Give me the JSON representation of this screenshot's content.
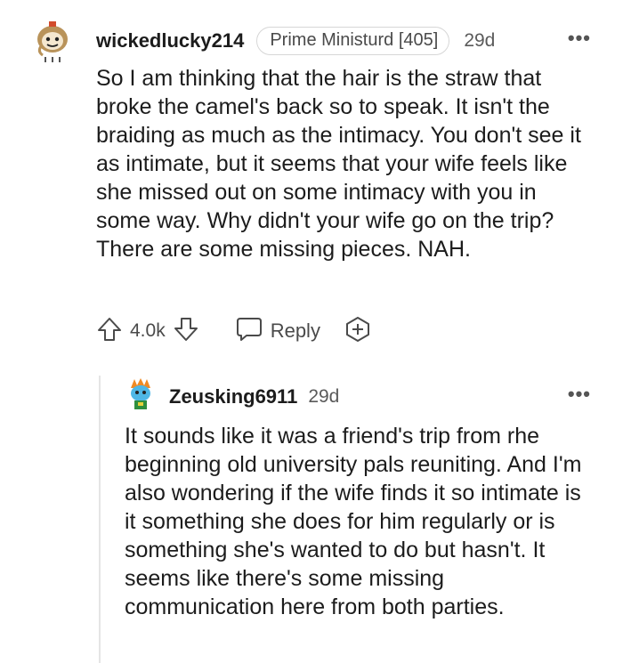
{
  "comments": [
    {
      "username": "wickedlucky214",
      "flair": "Prime Ministurd [405]",
      "time": "29d",
      "more": "•••",
      "body": "So I am thinking that the hair is the straw that broke the camel's back so to speak. It isn't the braiding as much as the intimacy. You don't see it as intimate, but it seems that your wife feels like she missed out on some intimacy with you in some way. Why didn't your wife go on the trip? There are some missing pieces. NAH.",
      "votes": "4.0k",
      "reply_label": "Reply",
      "icons": [
        "avatar-icon",
        "upvote-icon",
        "downvote-icon",
        "reply-icon",
        "award-icon",
        "more-options-icon"
      ]
    },
    {
      "username": "Zeusking6911",
      "time": "29d",
      "more": "•••",
      "body": "It sounds like it was a friend's trip from rhe beginning old university pals reuniting. And I'm also wondering if the wife finds it so intimate is it something she does for him regularly or is something she's wanted to do but hasn't. It seems like there's some missing communication here from both parties.",
      "icons": [
        "avatar-icon",
        "more-options-icon"
      ]
    }
  ],
  "colors": {
    "text": "#1c1c1c",
    "meta": "#5a5a5a",
    "icon": "#4a4a4a",
    "divider": "#e5e5e5"
  }
}
